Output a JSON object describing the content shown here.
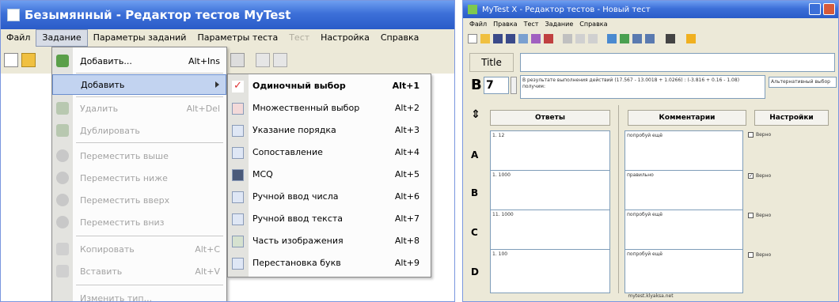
{
  "left_window": {
    "title": "Безымянный - Редактор тестов MyTest",
    "menu": [
      {
        "label": "Файл",
        "state": "normal"
      },
      {
        "label": "Задание",
        "state": "active"
      },
      {
        "label": "Параметры заданий",
        "state": "normal"
      },
      {
        "label": "Параметры теста",
        "state": "normal"
      },
      {
        "label": "Тест",
        "state": "disabled"
      },
      {
        "label": "Настройка",
        "state": "normal"
      },
      {
        "label": "Справка",
        "state": "normal"
      }
    ],
    "task_menu": {
      "items": [
        {
          "label": "Добавить...",
          "shortcut": "Alt+Ins",
          "disabled": false
        },
        {
          "label": "Добавить",
          "shortcut": "",
          "disabled": false,
          "highlighted": true,
          "submenu": true
        },
        {
          "label": "Удалить",
          "shortcut": "Alt+Del",
          "disabled": true
        },
        {
          "label": "Дублировать",
          "shortcut": "",
          "disabled": true
        },
        {
          "label": "Переместить выше",
          "shortcut": "",
          "disabled": true
        },
        {
          "label": "Переместить ниже",
          "shortcut": "",
          "disabled": true
        },
        {
          "label": "Переместить вверх",
          "shortcut": "",
          "disabled": true
        },
        {
          "label": "Переместить вниз",
          "shortcut": "",
          "disabled": true
        },
        {
          "label": "Копировать",
          "shortcut": "Alt+C",
          "disabled": true
        },
        {
          "label": "Вставить",
          "shortcut": "Alt+V",
          "disabled": true
        },
        {
          "label": "Изменить тип...",
          "shortcut": "",
          "disabled": true
        }
      ]
    },
    "add_submenu": {
      "items": [
        {
          "label": "Одиночный выбор",
          "shortcut": "Alt+1",
          "bold": true
        },
        {
          "label": "Множественный выбор",
          "shortcut": "Alt+2"
        },
        {
          "label": "Указание порядка",
          "shortcut": "Alt+3"
        },
        {
          "label": "Сопоставление",
          "shortcut": "Alt+4"
        },
        {
          "label": "MCQ",
          "shortcut": "Alt+5"
        },
        {
          "label": "Ручной ввод числа",
          "shortcut": "Alt+6"
        },
        {
          "label": "Ручной ввод текста",
          "shortcut": "Alt+7"
        },
        {
          "label": "Часть изображения",
          "shortcut": "Alt+8"
        },
        {
          "label": "Перестановка букв",
          "shortcut": "Alt+9"
        }
      ]
    }
  },
  "right_window": {
    "title": "МуTest X - Редактор тестов - Новый тест",
    "menu": [
      "Файл",
      "Правка",
      "Тест",
      "Задание",
      "Справка"
    ],
    "title_field_label": "Title",
    "title_value": "",
    "question_number_label": "В",
    "question_number": "7",
    "question_text": "В результате выполнения действий (17.567 - 13.0018 + 1.0266) : (-3.816 + 0.16 - 1.08) получим:",
    "question_type": "Альтернативный выбор",
    "headers": {
      "answers": "Ответы",
      "comments": "Комментарии",
      "settings": "Настройки"
    },
    "rows": [
      {
        "letter": "А",
        "answer": "1. 12",
        "comment": "попробуй ещё",
        "checkbox_label": "Верно",
        "checked": false
      },
      {
        "letter": "В",
        "answer": "1. 1000",
        "comment": "правильно",
        "checkbox_label": "Верно",
        "checked": true
      },
      {
        "letter": "С",
        "answer": "11. 1000",
        "comment": "попробуй ещё",
        "checkbox_label": "Верно",
        "checked": false
      },
      {
        "letter": "D",
        "answer": "1. 100",
        "comment": "попробуй ещё",
        "checkbox_label": "Верно",
        "checked": false
      }
    ],
    "status": "mytest.klyaksa.net"
  },
  "colors": {
    "titlebar": "#3c6fd8",
    "window_bg": "#ece9d8",
    "menu_highlight": "#c2d3f0",
    "disabled_text": "#a3a3a3"
  }
}
